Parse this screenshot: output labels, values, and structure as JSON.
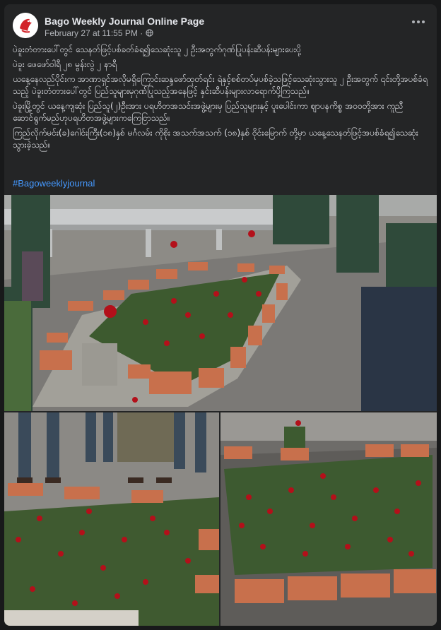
{
  "post": {
    "page_name": "Bago Weekly Journal Online Page",
    "timestamp": "February 27 at 11:55 PM",
    "audience_icon": "globe-icon",
    "more_icon": "more-options-icon",
    "paragraphs": [
      "ပဲခူးတံတားပေါ်တွင် သေနတ်ဖြင့်ပစ်ခတ်ခံရ၍သေဆုံးသူ ၂ ဦးအတွက်ဂုဏ်ပြုပန်းဆီပန်းများပေးပို့",
      "ပဲခူး ဖေဖော်ဝါရီ ၂၈ မွန်းလွဲ ၂ နာရီ",
      "ယနေ့နေလည်ပိုင်းက အာဏာရှင်အလိုမရှိကြောင်းဆန္ဒဖော်ထုတ်ရင်း ရဲနှင့်စစ်တပ်မှပစ်ခဲ့သဖြင့်သေဆုံးသွားသူ ၂ ဦးအတွက် ၎င်းတို့အပစ်ခံရသည့် ပဲခူးတံတားပေါ်တွင် ပြည်သူများမှဂုဏ်ပြုသည့်အနေဖြင့် နှင်းဆီပန်းများလာရောက်ပို့ကြသည်။",
      "ပဲခူးမြို့တွင် ယနေ့ကျဆုံး ပြည်သူ(၂)ဦးအား ပရဟိတအသင်းအဖွဲ့များမှ ပြည်သူများနှင့် ပူးပေါင်းကာ ဈာပနကိစ္စ အဝဝတို့အား ကူညီဆောင်ရွက်မည်ဟုပရဟိတအဖွဲ့များကကြေငြာသည်။",
      "ကြည်လိုက်မင်း(ခ)ဂေါင်းကြီး(၁၈)နှစ် မင်္ဂလမ်း ကိုစိုး အသက်အသက် (၁၈)နှစ် ဝိုင်းမြောက် တို့မှာ ယနေ့သေနတ်ဖြင့်အပစ်ခံရ၍သေဆုံးသွားခဲ့သည်။"
    ],
    "hashtag": "#Bagoweeklyjournal"
  },
  "colors": {
    "background": "#18191a",
    "card": "#242526",
    "text_primary": "#e4e6eb",
    "text_secondary": "#b0b3b8",
    "link": "#4599ff"
  },
  "photos": [
    {
      "subject": "Roses and bricks laid in a rectangle on the bridge road, people standing nearby"
    },
    {
      "subject": "People standing beside bricks and scattered red roses"
    },
    {
      "subject": "Bricks and red roses arranged on the asphalt road"
    }
  ]
}
